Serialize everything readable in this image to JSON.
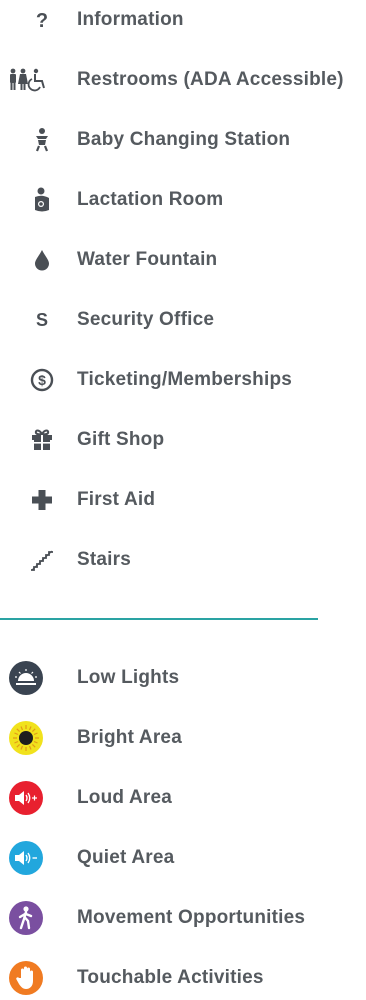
{
  "amenities": [
    {
      "label": "Information",
      "icon": "question-mark-icon"
    },
    {
      "label": "Restrooms (ADA Accessible)",
      "icon": "restroom-icon"
    },
    {
      "label": "Baby Changing Station",
      "icon": "baby-changing-icon"
    },
    {
      "label": "Lactation Room",
      "icon": "lactation-icon"
    },
    {
      "label": "Water Fountain",
      "icon": "water-drop-icon"
    },
    {
      "label": "Security Office",
      "icon": "security-s-icon"
    },
    {
      "label": "Ticketing/Memberships",
      "icon": "dollar-circle-icon"
    },
    {
      "label": "Gift Shop",
      "icon": "gift-icon"
    },
    {
      "label": "First Aid",
      "icon": "first-aid-cross-icon"
    },
    {
      "label": "Stairs",
      "icon": "stairs-icon"
    }
  ],
  "sensory": [
    {
      "label": "Low Lights",
      "icon": "low-lights-icon",
      "color": "#3a4451"
    },
    {
      "label": "Bright Area",
      "icon": "bright-sun-icon",
      "color": "#f1e21d"
    },
    {
      "label": "Loud Area",
      "icon": "loud-speaker-icon",
      "color": "#e8202f"
    },
    {
      "label": "Quiet Area",
      "icon": "quiet-speaker-icon",
      "color": "#22a7dd"
    },
    {
      "label": "Movement Opportunities",
      "icon": "walking-person-icon",
      "color": "#7a4fa0"
    },
    {
      "label": "Touchable Activities",
      "icon": "hand-icon",
      "color": "#f07b22"
    }
  ],
  "divider_color": "#2aa3a3",
  "icon_color": "#4a4f55",
  "text_color": "#555a5f"
}
